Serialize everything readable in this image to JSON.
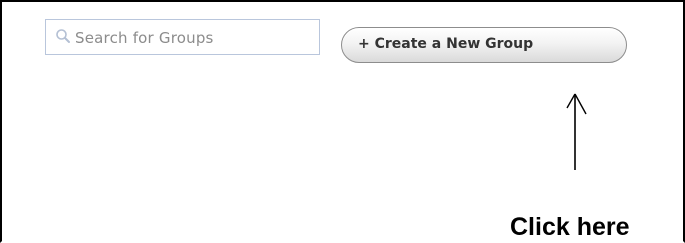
{
  "search": {
    "placeholder": "Search for Groups",
    "icon": "search-icon"
  },
  "create_group": {
    "label": "+ Create a New Group"
  },
  "annotation": {
    "text": "Click here",
    "icon": "arrow-up-icon"
  },
  "colors": {
    "input_border": "#b9c6dc",
    "placeholder_text": "#8c8c8c",
    "button_border": "#8d8d8d",
    "button_text": "#333333",
    "annotation_text": "#000000"
  }
}
